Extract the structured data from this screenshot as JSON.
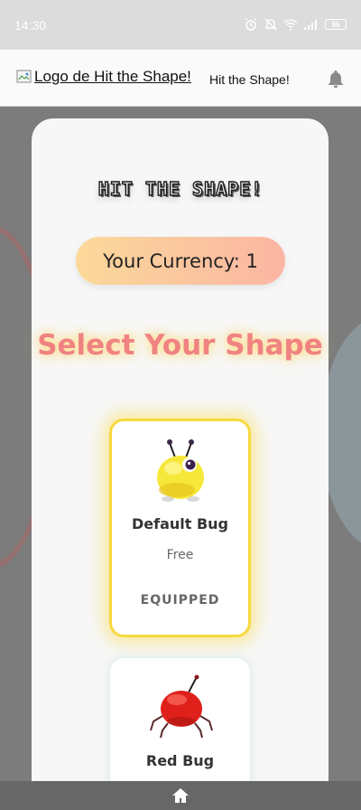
{
  "status_bar": {
    "time": "14:30",
    "battery": "96"
  },
  "app_bar": {
    "logo_alt": "Logo de Hit the Shape!",
    "title": "Hit the Shape!"
  },
  "game": {
    "logo_text": "HIT THE SHAPE!",
    "currency_label": "Your Currency: 1",
    "select_title": "Select Your Shape"
  },
  "shapes": [
    {
      "name": "Default Bug",
      "price": "Free",
      "status": "EQUIPPED",
      "color": "#f6e83a"
    },
    {
      "name": "Red Bug",
      "color": "#e0211b"
    }
  ],
  "colors": {
    "equipped_border": "#f7d93d",
    "title_pink": "#f08282",
    "currency_from": "#fbd99a",
    "currency_to": "#fbb5a3"
  }
}
